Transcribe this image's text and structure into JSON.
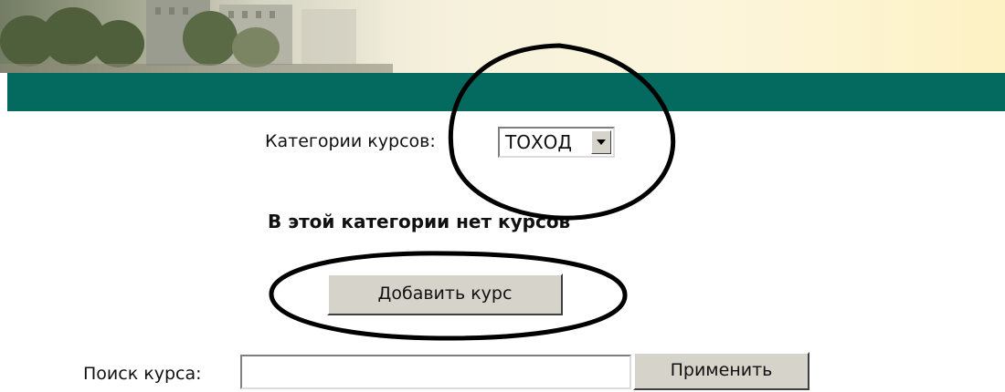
{
  "categories": {
    "label": "Категории курсов:",
    "selected": "ТОХОД"
  },
  "empty_message": "В этой категории нет курсов",
  "add_course_button": "Добавить курс",
  "search": {
    "label": "Поиск курса:",
    "value": "",
    "apply_button": "Применить"
  },
  "colors": {
    "teal_bar": "#046a60",
    "button_face": "#d6d3cb",
    "annotation_ink": "#000000"
  }
}
